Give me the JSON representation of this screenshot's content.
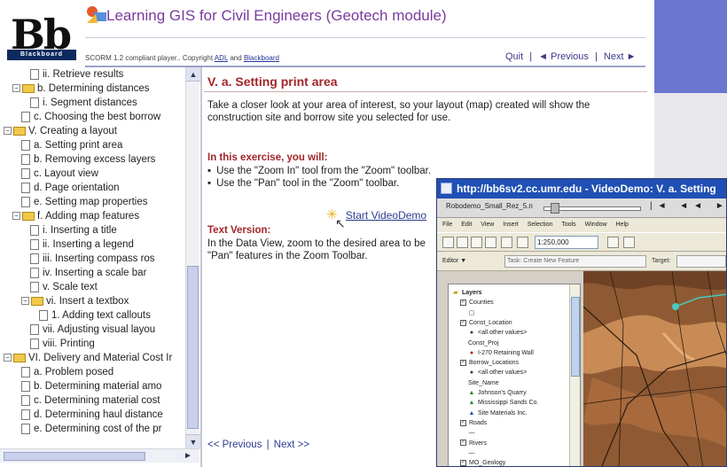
{
  "header": {
    "logo_letters": "Bb",
    "logo_strip": "Blackboard",
    "course_title": "Learning GIS for Civil Engineers (Geotech module)",
    "scorm_note_prefix": "SCORM 1.2 compliant player.. Copyright",
    "scorm_link_adl": "ADL",
    "scorm_and": "and",
    "scorm_link_blackboard": "Blackboard",
    "nav_quit": "Quit",
    "nav_sep": "|",
    "nav_previous": "◄ Previous",
    "nav_next": "Next ►"
  },
  "tree": {
    "items": [
      {
        "label": "ii. Retrieve results",
        "indent": 3,
        "kind": "page"
      },
      {
        "label": "b. Determining distances",
        "indent": 1,
        "kind": "folder",
        "toggle": "−"
      },
      {
        "label": "i. Segment distances",
        "indent": 3,
        "kind": "page"
      },
      {
        "label": "c. Choosing the best borrow",
        "indent": 2,
        "kind": "page"
      },
      {
        "label": "V. Creating a layout",
        "indent": 0,
        "kind": "folder",
        "toggle": "−"
      },
      {
        "label": "a. Setting print area",
        "indent": 2,
        "kind": "page"
      },
      {
        "label": "b. Removing excess layers",
        "indent": 2,
        "kind": "page"
      },
      {
        "label": "c. Layout view",
        "indent": 2,
        "kind": "page"
      },
      {
        "label": "d. Page orientation",
        "indent": 2,
        "kind": "page"
      },
      {
        "label": "e. Setting map properties",
        "indent": 2,
        "kind": "page"
      },
      {
        "label": "f. Adding map features",
        "indent": 1,
        "kind": "folder",
        "toggle": "−"
      },
      {
        "label": "i. Inserting a title",
        "indent": 3,
        "kind": "page"
      },
      {
        "label": "ii. Inserting a legend",
        "indent": 3,
        "kind": "page"
      },
      {
        "label": "iii. Inserting compass ros",
        "indent": 3,
        "kind": "page"
      },
      {
        "label": "iv. Inserting a scale bar",
        "indent": 3,
        "kind": "page"
      },
      {
        "label": "v. Scale text",
        "indent": 3,
        "kind": "page"
      },
      {
        "label": "vi. Insert a textbox",
        "indent": 2,
        "kind": "folder",
        "toggle": "−"
      },
      {
        "label": "1. Adding text callouts",
        "indent": 4,
        "kind": "page"
      },
      {
        "label": "vii. Adjusting visual layou",
        "indent": 3,
        "kind": "page"
      },
      {
        "label": "viii. Printing",
        "indent": 3,
        "kind": "page"
      },
      {
        "label": "VI. Delivery and Material Cost Ir",
        "indent": 0,
        "kind": "folder",
        "toggle": "−"
      },
      {
        "label": "a. Problem posed",
        "indent": 2,
        "kind": "page"
      },
      {
        "label": "b. Determining material amo",
        "indent": 2,
        "kind": "page"
      },
      {
        "label": "c. Determining material cost",
        "indent": 2,
        "kind": "page"
      },
      {
        "label": "d. Determining haul distance",
        "indent": 2,
        "kind": "page"
      },
      {
        "label": "e. Determining cost of the pr",
        "indent": 2,
        "kind": "page"
      }
    ],
    "scroll_up": "▲",
    "scroll_down": "▼",
    "scroll_right": "►"
  },
  "content": {
    "section_title": "V. a. Setting print area",
    "intro": "Take a closer look at your area of interest, so your layout (map) created will show the construction site and borrow site you selected for use.",
    "exercise_heading": "In this exercise, you will:",
    "exercise_items": [
      "Use the \"Zoom In\" tool from the \"Zoom\" toolbar.",
      "Use the \"Pan\" tool in the \"Zoom\" toolbar."
    ],
    "video_icon": "✳",
    "video_link": "Start VideoDemo",
    "cursor_icon": "↖",
    "text_version_heading": "Text Version:",
    "text_version_body": "In the Data View, zoom to the desired area to be \"Pan\" features in the Zoom Toolbar.",
    "bottom_prev": "<< Previous",
    "bottom_sep": "|",
    "bottom_next": "Next >>"
  },
  "video_window": {
    "title": "http://bb6sv2.cc.umr.edu - VideoDemo: V. a. Setting",
    "player_label": "Robodemo_Small_Rez_5.n",
    "player_controls": "|◄ ◄◄ ►",
    "menu": [
      "File",
      "Edit",
      "View",
      "Insert",
      "Selection",
      "Tools",
      "Window",
      "Help"
    ],
    "scale_value": "1:250,000",
    "editor_label": "Editor ▼",
    "task_label": "Task:",
    "task_value": "Create New Feature",
    "target_label": "Target:",
    "toc": [
      {
        "label": "Layers",
        "indent": 0,
        "sym": "folder",
        "check": false,
        "bold": true
      },
      {
        "label": "Counties",
        "indent": 1,
        "sym": "",
        "check": true
      },
      {
        "label": "",
        "indent": 2,
        "sym": "box",
        "check": false
      },
      {
        "label": "Const_Location",
        "indent": 1,
        "sym": "",
        "check": true
      },
      {
        "label": "<all other values>",
        "indent": 2,
        "sym": "dot",
        "check": false
      },
      {
        "label": "Const_Proj",
        "indent": 2,
        "sym": "",
        "check": false
      },
      {
        "label": "I-270 Retaining Wall",
        "indent": 2,
        "sym": "reddot",
        "check": false
      },
      {
        "label": "Borrow_Locations",
        "indent": 1,
        "sym": "",
        "check": true
      },
      {
        "label": "<all other values>",
        "indent": 2,
        "sym": "dot",
        "check": false
      },
      {
        "label": "Site_Name",
        "indent": 2,
        "sym": "",
        "check": false
      },
      {
        "label": "Johnson's Quarry",
        "indent": 2,
        "sym": "greentri",
        "check": false
      },
      {
        "label": "Mississippi Sands Co.",
        "indent": 2,
        "sym": "greentri",
        "check": false
      },
      {
        "label": "Site Materials Inc.",
        "indent": 2,
        "sym": "bluetri",
        "check": false
      },
      {
        "label": "Roads",
        "indent": 1,
        "sym": "",
        "check": true
      },
      {
        "label": "",
        "indent": 2,
        "sym": "line",
        "check": false
      },
      {
        "label": "Rivers",
        "indent": 1,
        "sym": "",
        "check": true
      },
      {
        "label": "",
        "indent": 2,
        "sym": "line",
        "check": false
      },
      {
        "label": "MO_Geology",
        "indent": 1,
        "sym": "",
        "check": true
      }
    ]
  },
  "colors": {
    "heading_red": "#a2262a",
    "link_blue": "#2d3c8f",
    "title_purple": "#7a3a9e",
    "band_blue": "#6b77cf",
    "map_brown": "#8f5a33"
  }
}
